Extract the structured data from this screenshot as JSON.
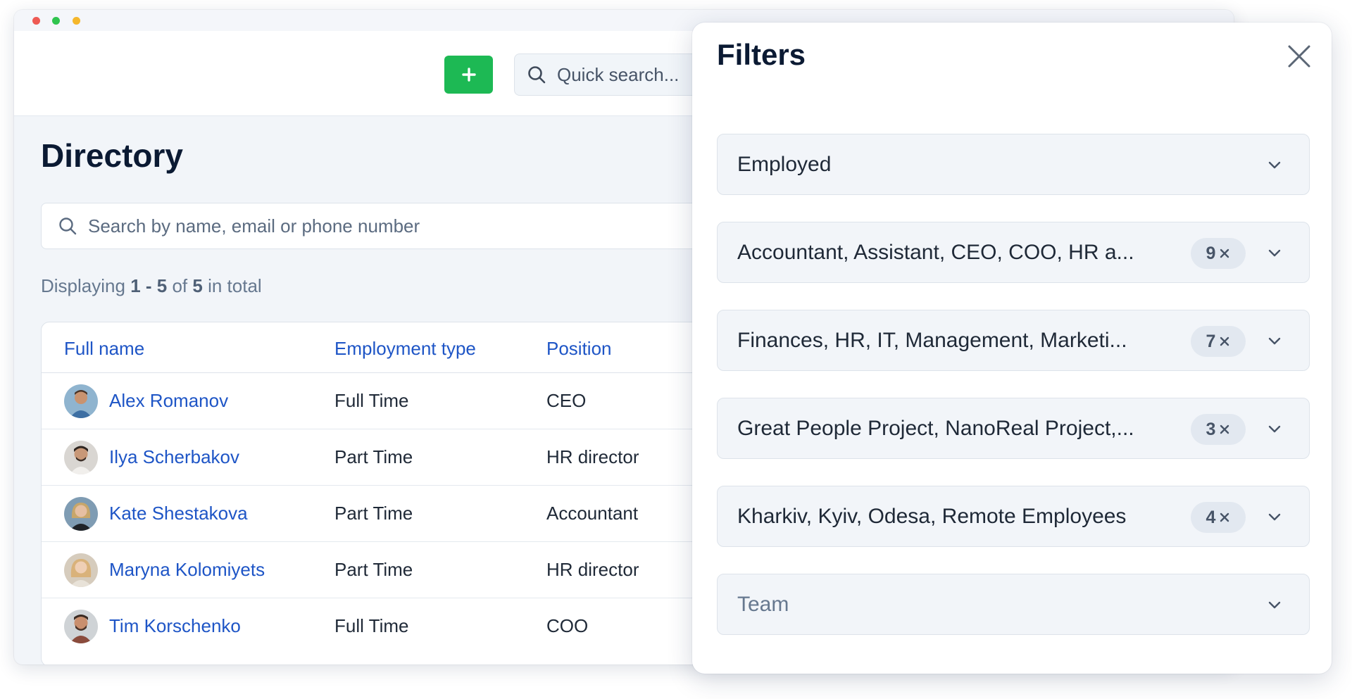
{
  "topbar": {
    "add_button_icon": "plus-icon",
    "quick_search_placeholder": "Quick search...",
    "quick_search_icon": "search-icon"
  },
  "directory": {
    "title": "Directory",
    "search_placeholder": "Search by name, email or phone number",
    "displaying": {
      "prefix": "Displaying",
      "range": "1 - 5",
      "of": "of",
      "total": "5",
      "suffix": "in total"
    },
    "columns": [
      "Full name",
      "Employment type",
      "Position"
    ],
    "rows": [
      {
        "name": "Alex Romanov",
        "employment": "Full Time",
        "position": "CEO"
      },
      {
        "name": "Ilya Scherbakov",
        "employment": "Part Time",
        "position": "HR director"
      },
      {
        "name": "Kate Shestakova",
        "employment": "Part Time",
        "position": "Accountant"
      },
      {
        "name": "Maryna Kolomiyets",
        "employment": "Part Time",
        "position": "HR director"
      },
      {
        "name": "Tim Korschenko",
        "employment": "Full Time",
        "position": "COO"
      }
    ]
  },
  "filters": {
    "title": "Filters",
    "close_icon": "close-icon",
    "items": [
      {
        "value": "Employed",
        "count": ""
      },
      {
        "value": "Accountant, Assistant, CEO, COO, HR a...",
        "count": "9"
      },
      {
        "value": "Finances, HR, IT, Management, Marketi...",
        "count": "7"
      },
      {
        "value": "Great People Project, NanoReal Project,...",
        "count": "3"
      },
      {
        "value": "Kharkiv, Kyiv, Odesa, Remote Employees",
        "count": "4"
      },
      {
        "value": "Team",
        "count": ""
      }
    ]
  },
  "colors": {
    "accent_green": "#1db954",
    "link_blue": "#1e55c6",
    "title_dark": "#0b1a33"
  }
}
